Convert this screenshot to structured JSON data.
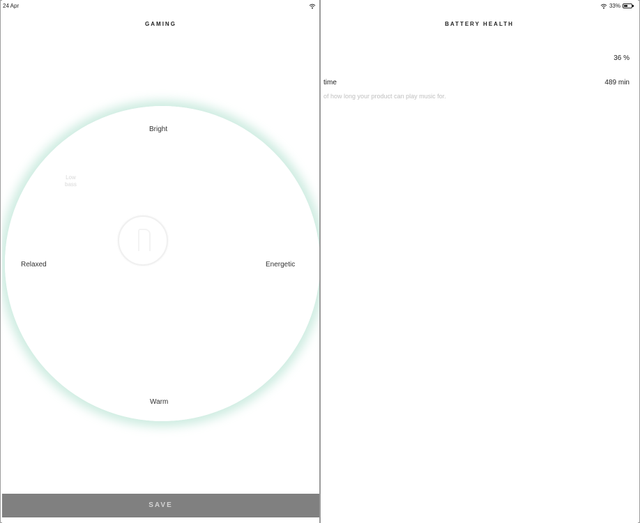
{
  "left_panel": {
    "status_date": "24 Apr",
    "title": "GAMING",
    "wheel": {
      "top_label": "Bright",
      "left_label": "Relaxed",
      "right_label": "Energetic",
      "bottom_label": "Warm",
      "upper_left_faint": [
        "Low",
        "bass"
      ]
    },
    "save_label": "SAVE"
  },
  "right_panel": {
    "status_battery_pct": "33%",
    "title": "BATTERY HEALTH",
    "health_value": "36 %",
    "time_label": "time",
    "time_value": "489 min",
    "description": "of how long your product can play music for."
  },
  "colors": {
    "wheel_glow": "#bee6d7",
    "save_bar": "#808080",
    "divider": "#9a9a9a"
  },
  "icons": [
    "wifi-icon",
    "battery-icon",
    "mood-knob-icon"
  ]
}
